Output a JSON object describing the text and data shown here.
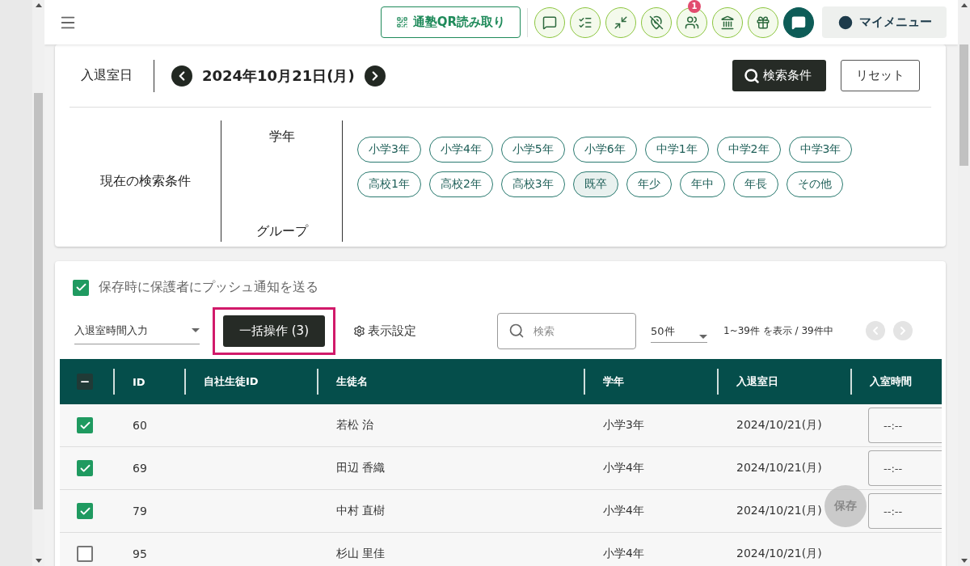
{
  "header": {
    "qr_button": "通塾QR読み取り",
    "notification_badge": "1",
    "my_menu": "マイメニュー"
  },
  "date_bar": {
    "label": "入退室日",
    "date": "2024年10月21日(月)",
    "search_button": "検索条件",
    "reset_button": "リセット"
  },
  "conditions": {
    "title": "現在の検索条件",
    "grade_label": "学年",
    "group_label": "グループ",
    "grades": [
      {
        "label": "小学3年",
        "selected": false
      },
      {
        "label": "小学4年",
        "selected": false
      },
      {
        "label": "小学5年",
        "selected": false
      },
      {
        "label": "小学6年",
        "selected": false
      },
      {
        "label": "中学1年",
        "selected": false
      },
      {
        "label": "中学2年",
        "selected": false
      },
      {
        "label": "中学3年",
        "selected": false
      },
      {
        "label": "高校1年",
        "selected": false
      },
      {
        "label": "高校2年",
        "selected": false
      },
      {
        "label": "高校3年",
        "selected": false
      },
      {
        "label": "既卒",
        "selected": true
      },
      {
        "label": "年少",
        "selected": false
      },
      {
        "label": "年中",
        "selected": false
      },
      {
        "label": "年長",
        "selected": false
      },
      {
        "label": "その他",
        "selected": false
      }
    ]
  },
  "list": {
    "push_notify": {
      "label": "保存時に保護者にプッシュ通知を送る",
      "checked": true
    },
    "mode_select": "入退室時間入力",
    "bulk_button": "一括操作 (3)",
    "display_settings": "表示設定",
    "search_placeholder": "検索",
    "page_size": "50件",
    "range": "1~39件 を表示 / 39件中",
    "header_indeterminate": true,
    "columns": [
      "ID",
      "自社生徒ID",
      "生徒名",
      "学年",
      "入退室日",
      "入室時間"
    ],
    "rows": [
      {
        "checked": true,
        "id": "60",
        "name": "若松 治",
        "grade": "小学3年",
        "date": "2024/10/21(月)",
        "entry_time": "--:--"
      },
      {
        "checked": true,
        "id": "69",
        "name": "田辺 香織",
        "grade": "小学4年",
        "date": "2024/10/21(月)",
        "entry_time": "--:--"
      },
      {
        "checked": true,
        "id": "79",
        "name": "中村 直樹",
        "grade": "小学4年",
        "date": "2024/10/21(月)",
        "entry_time": "--:--"
      },
      {
        "checked": false,
        "id": "95",
        "name": "杉山 里佳",
        "grade": "小学4年",
        "date": "2024/10/21(月)"
      }
    ],
    "save_button": "保存"
  }
}
